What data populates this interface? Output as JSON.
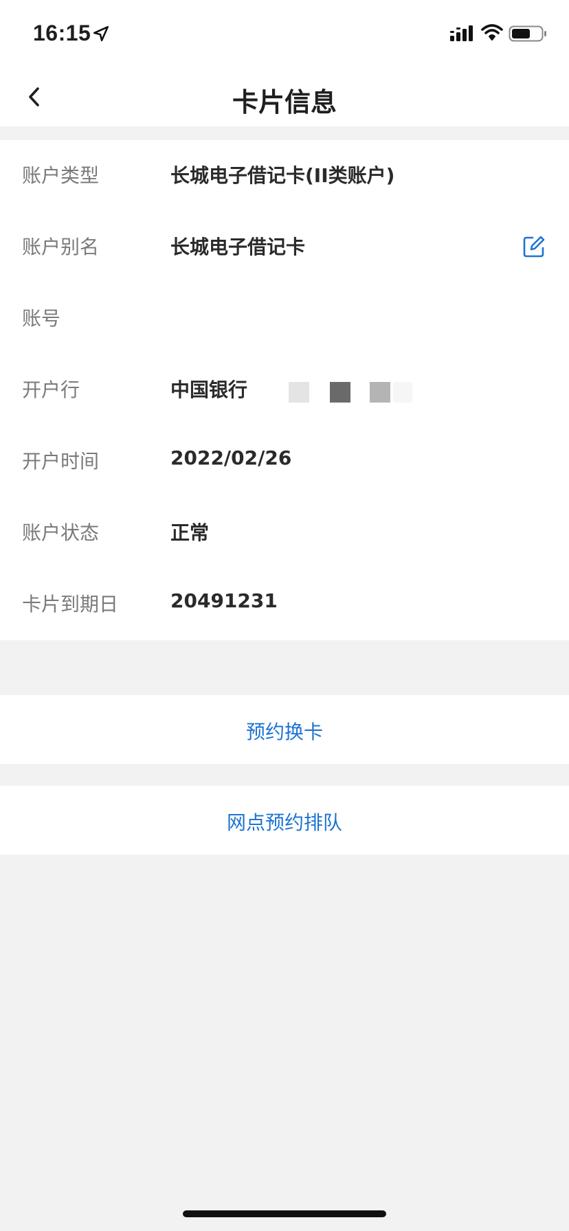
{
  "status_bar": {
    "time": "16:15",
    "icons": [
      "location-arrow-icon",
      "cellular-signal-icon",
      "wifi-icon",
      "battery-icon"
    ]
  },
  "nav": {
    "title": "卡片信息",
    "back_icon": "chevron-left-icon"
  },
  "info": {
    "rows": [
      {
        "label": "账户类型",
        "value": "长城电子借记卡(II类账户)"
      },
      {
        "label": "账户别名",
        "value": "长城电子借记卡",
        "icon": "edit-icon"
      },
      {
        "label": "账号",
        "value": ""
      },
      {
        "label": "开户行",
        "value": "中国银行"
      },
      {
        "label": "开户时间",
        "value": "2022/02/26"
      },
      {
        "label": "账户状态",
        "value": "正常"
      },
      {
        "label": "卡片到期日",
        "value": "20491231"
      }
    ]
  },
  "actions": {
    "card_replacement": "预约换卡",
    "branch_queue": "网点预约排队"
  },
  "colors": {
    "accent": "#1e73d2",
    "label": "#7a7a7a",
    "value": "#2a2a2a",
    "background": "#f2f2f2",
    "surface": "#ffffff"
  }
}
